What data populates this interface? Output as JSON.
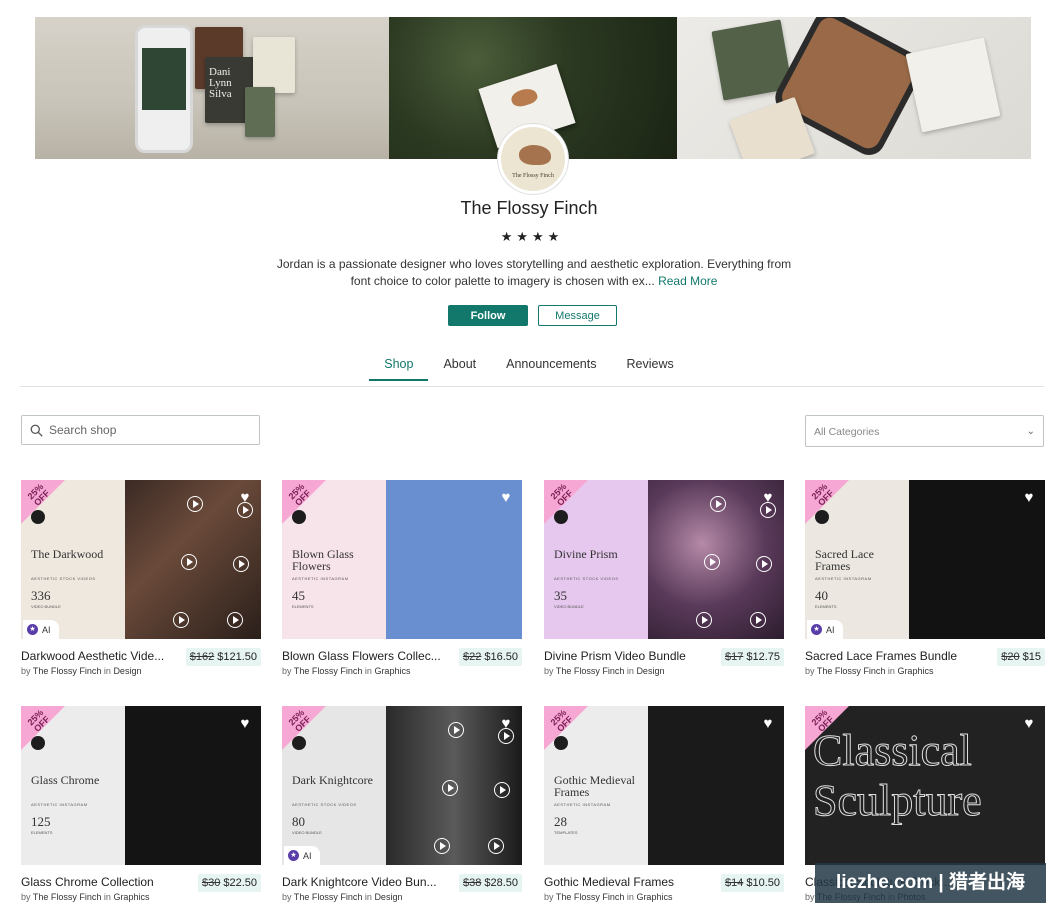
{
  "shop": {
    "name": "The Flossy Finch",
    "avatar_text": "The Flossy Finch",
    "rating_stars": "★★★★",
    "bio": "Jordan is a passionate designer who loves storytelling and aesthetic exploration. Everything from font choice to color palette to imagery is chosen with ex... ",
    "read_more": "Read More",
    "follow_label": "Follow",
    "message_label": "Message"
  },
  "banner": {
    "phone_names": "Dani Lynn Silva",
    "postcard_text": "The Flossy Finch"
  },
  "tabs": [
    {
      "label": "Shop",
      "active": true
    },
    {
      "label": "About",
      "active": false
    },
    {
      "label": "Announcements",
      "active": false
    },
    {
      "label": "Reviews",
      "active": false
    }
  ],
  "search": {
    "placeholder": "Search shop"
  },
  "category": {
    "label": "All Categories"
  },
  "badge": {
    "line1": "25%",
    "line2": "OFF"
  },
  "ai_label": "AI",
  "by_prefix": "by",
  "in_word": "in",
  "products": [
    {
      "name": "Darkwood Aesthetic Vide...",
      "old_price": "$162",
      "price": "$121.50",
      "seller": "The Flossy Finch",
      "category": "Design",
      "thumb_title": "The Darkwood",
      "thumb_sub": "AESTHETIC STOCK VIDEOS",
      "thumb_count": "336",
      "thumb_count_label": "VIDEO BUNDLE",
      "ai": true
    },
    {
      "name": "Blown Glass Flowers Collec...",
      "old_price": "$22",
      "price": "$16.50",
      "seller": "The Flossy Finch",
      "category": "Graphics",
      "thumb_title": "Blown Glass Flowers",
      "thumb_sub": "AESTHETIC INSTAGRAM",
      "thumb_count": "45",
      "thumb_count_label": "ELEMENTS",
      "ai": false
    },
    {
      "name": "Divine Prism Video Bundle",
      "old_price": "$17",
      "price": "$12.75",
      "seller": "The Flossy Finch",
      "category": "Design",
      "thumb_title": "Divine Prism",
      "thumb_sub": "AESTHETIC STOCK VIDEOS",
      "thumb_count": "35",
      "thumb_count_label": "VIDEO BUNDLE",
      "ai": false
    },
    {
      "name": "Sacred Lace Frames Bundle",
      "old_price": "$20",
      "price": "$15",
      "seller": "The Flossy Finch",
      "category": "Graphics",
      "thumb_title": "Sacred Lace Frames",
      "thumb_sub": "AESTHETIC INSTAGRAM",
      "thumb_count": "40",
      "thumb_count_label": "ELEMENTS",
      "ai": true
    },
    {
      "name": "Glass Chrome Collection",
      "old_price": "$30",
      "price": "$22.50",
      "seller": "The Flossy Finch",
      "category": "Graphics",
      "thumb_title": "Glass Chrome",
      "thumb_sub": "AESTHETIC INSTAGRAM",
      "thumb_count": "125",
      "thumb_count_label": "ELEMENTS",
      "ai": false
    },
    {
      "name": "Dark Knightcore Video Bun...",
      "old_price": "$38",
      "price": "$28.50",
      "seller": "The Flossy Finch",
      "category": "Design",
      "thumb_title": "Dark Knightcore",
      "thumb_sub": "AESTHETIC STOCK VIDEOS",
      "thumb_count": "80",
      "thumb_count_label": "VIDEO BUNDLE",
      "ai": true
    },
    {
      "name": "Gothic Medieval Frames",
      "old_price": "$14",
      "price": "$10.50",
      "seller": "The Flossy Finch",
      "category": "Graphics",
      "thumb_title": "Gothic Medieval Frames",
      "thumb_sub": "AESTHETIC INSTAGRAM",
      "thumb_count": "28",
      "thumb_count_label": "TEMPLATES",
      "ai": false
    },
    {
      "name": "Classical Sculpture Stock...",
      "old_price": "",
      "price": "",
      "seller": "The Flossy Finch",
      "category": "Photos",
      "thumb_title": "Classical Sculpture",
      "thumb_sub": "",
      "thumb_count": "",
      "thumb_count_label": "",
      "ai": false
    }
  ],
  "watermark": "liezhe.com | 猎者出海",
  "colors": {
    "accent": "#12786b",
    "badge": "#f6a7d3",
    "price_bg": "#e6f4f2"
  }
}
